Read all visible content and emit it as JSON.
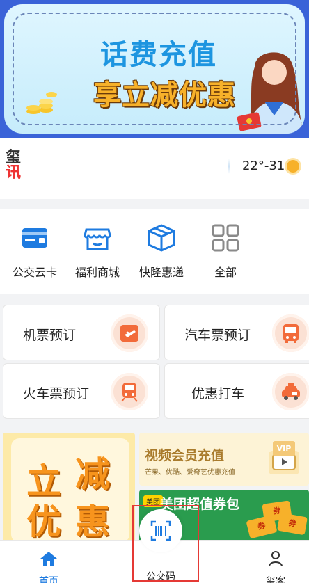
{
  "banner": {
    "title": "话费充值",
    "subtitle": "享立减优惠"
  },
  "info_bar": {
    "logo_line1": "玺",
    "logo_line2": "讯",
    "temperature": "22°-31°",
    "weather_icon": "sun-icon"
  },
  "services": [
    {
      "label": "公交云卡",
      "icon": "bus-card-icon"
    },
    {
      "label": "福利商城",
      "icon": "shop-icon"
    },
    {
      "label": "快隆惠递",
      "icon": "package-icon"
    },
    {
      "label": "全部",
      "icon": "grid-icon"
    }
  ],
  "travel_cards": [
    {
      "label": "机票预订",
      "icon": "plane-ticket-icon"
    },
    {
      "label": "汽车票预订",
      "icon": "bus-icon"
    },
    {
      "label": "火车票预订",
      "icon": "train-icon"
    },
    {
      "label": "优惠打车",
      "icon": "taxi-icon"
    }
  ],
  "promos": {
    "left_chars": [
      "立",
      "减",
      "优",
      "惠"
    ],
    "video": {
      "title": "视频会员充值",
      "subtitle": "芒果、优酷、爱奇艺优惠充值",
      "badge": "VIP"
    },
    "meituan": {
      "tag": "美团",
      "title": "美团超值券包",
      "tickets": [
        "券",
        "券",
        "券"
      ]
    }
  },
  "bottom_nav": {
    "home": "首页",
    "bus_code": "公交码",
    "profile": "玺客"
  },
  "colors": {
    "accent": "#1e7be0",
    "banner_bg": "#3a63d8",
    "highlight": "#e53935"
  }
}
